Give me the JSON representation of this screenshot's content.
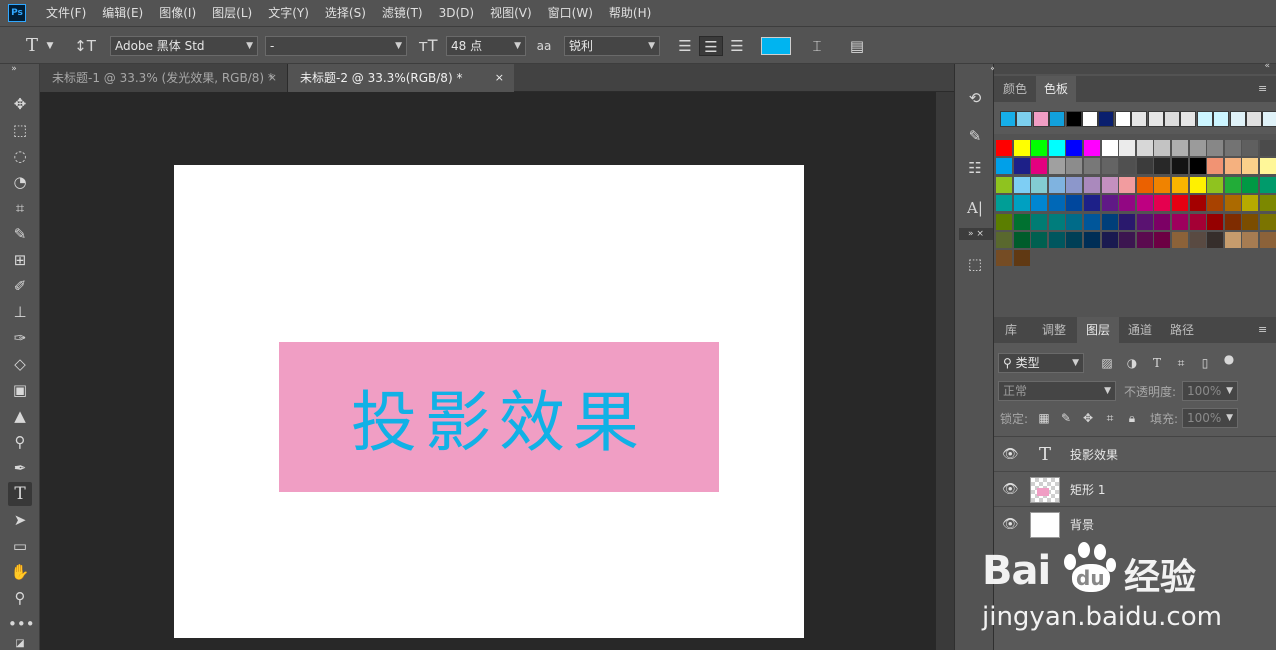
{
  "app": {
    "logo": "Ps"
  },
  "menu": [
    "文件(F)",
    "编辑(E)",
    "图像(I)",
    "图层(L)",
    "文字(Y)",
    "选择(S)",
    "滤镜(T)",
    "3D(D)",
    "视图(V)",
    "窗口(W)",
    "帮助(H)"
  ],
  "options": {
    "font_family": "Adobe 黑体 Std",
    "font_style": "-",
    "font_size": "48 点",
    "antialias_icon": "aa",
    "antialias": "锐利",
    "text_color": "#00b4f0"
  },
  "tabs": [
    {
      "label": "未标题-1 @ 33.3% (发光效果, RGB/8) *",
      "close": "×"
    },
    {
      "label": "未标题-2 @ 33.3%(RGB/8) *",
      "close": "×"
    }
  ],
  "document": {
    "text": "投影效果",
    "rect_color": "#f09ec4",
    "text_color": "#11b1e6"
  },
  "swatches_panel": {
    "tabs": [
      "颜色",
      "色板"
    ],
    "recent": [
      "#16aee8",
      "#7ccfee",
      "#f09ec4",
      "#12a0dc",
      "#000000",
      "#ffffff",
      "#0a1f6e",
      "#ffffff",
      "#e6e6e6",
      "#e6e6e6",
      "#dcdcdc",
      "#e6e6e6",
      "#ccf5ff",
      "#ccf5ff",
      "#e0f2f8",
      "#e0e0e0",
      "#e0f2f8"
    ],
    "grid": [
      [
        "#ff0000",
        "#ffff00",
        "#00ff00",
        "#00ffff",
        "#0000ff",
        "#ff00ff",
        "#ffffff",
        "#ebebeb",
        "#d7d7d7",
        "#c3c3c3",
        "#afafaf",
        "#9b9b9b",
        "#878787",
        "#737373",
        "#5f5f5f",
        "#4b4b4b"
      ],
      [
        "#00a0e9",
        "#1d2088",
        "#e4007f",
        "#a0a0a0",
        "#8c8c8c",
        "#787878",
        "#646464",
        "#505050",
        "#3c3c3c",
        "#282828",
        "#141414",
        "#000000",
        "#f19373",
        "#f5b17f",
        "#fad08a",
        "#fff799"
      ],
      [
        "#8fc31f",
        "#7ecef4",
        "#83ccd2",
        "#7fb3e0",
        "#8c97cb",
        "#aa89bd",
        "#c490bf",
        "#f29c9f",
        "#eb6100",
        "#f08300",
        "#f8b500",
        "#fff100",
        "#8fc31f",
        "#22ac38",
        "#009944",
        "#009b6b"
      ],
      [
        "#009e96",
        "#00a0c1",
        "#0086d1",
        "#0068b7",
        "#00479d",
        "#1d2088",
        "#601986",
        "#920783",
        "#be0081",
        "#e5004f",
        "#e60012",
        "#a40000",
        "#a84200",
        "#ac6a00",
        "#b7aa00",
        "#7c8800"
      ],
      [
        "#5b7e00",
        "#007130",
        "#007c73",
        "#007d7c",
        "#006b89",
        "#00569a",
        "#003f7a",
        "#2a196d",
        "#5a1271",
        "#7c0065",
        "#9e005d",
        "#a40035",
        "#950000",
        "#7e2c00",
        "#7b4d00",
        "#7b7400"
      ],
      [
        "#59682e",
        "#005c2b",
        "#006050",
        "#00565e",
        "#003f56",
        "#002e56",
        "#1a1a50",
        "#3c1650",
        "#5b0a4f",
        "#6c0043",
        "#8c6239",
        "#594a42",
        "#362e2b",
        "#c69c6d",
        "#a67c52",
        "#8c6239"
      ],
      [
        "#754c24",
        "#603913"
      ]
    ]
  },
  "layers_panel": {
    "tabs": [
      "库",
      "调整",
      "图层",
      "通道",
      "路径"
    ],
    "filter_kind": "类型",
    "blend_mode": "正常",
    "opacity_label": "不透明度:",
    "opacity": "100%",
    "lock_label": "锁定:",
    "fill_label": "填充:",
    "fill": "100%",
    "layers": [
      {
        "name": "投影效果",
        "type": "text",
        "visible": true
      },
      {
        "name": "矩形 1",
        "type": "shape",
        "visible": true
      },
      {
        "name": "背景",
        "type": "background",
        "visible": true
      }
    ]
  },
  "watermark": {
    "brand": "Bai",
    "brand2": "du",
    "cn": "经验",
    "url": "jingyan.baidu.com"
  }
}
